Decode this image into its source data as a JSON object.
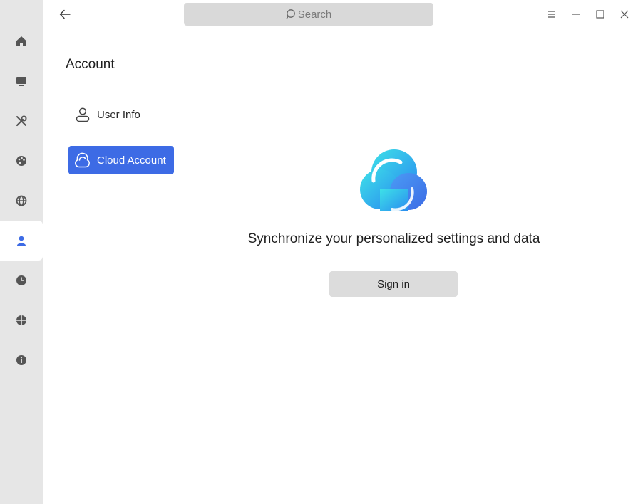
{
  "search": {
    "placeholder": "Search"
  },
  "rail": {
    "items": [
      {
        "name": "home",
        "icon": "home-icon"
      },
      {
        "name": "display",
        "icon": "monitor-icon"
      },
      {
        "name": "system",
        "icon": "tools-icon"
      },
      {
        "name": "personalize",
        "icon": "palette-icon"
      },
      {
        "name": "network",
        "icon": "globe-icon"
      },
      {
        "name": "account",
        "icon": "user-icon",
        "active": true
      },
      {
        "name": "datetime",
        "icon": "clock-icon"
      },
      {
        "name": "update",
        "icon": "update-icon"
      },
      {
        "name": "about",
        "icon": "info-icon"
      }
    ]
  },
  "nav": {
    "section_title": "Account",
    "items": [
      {
        "label": "User Info",
        "icon": "user-outline-icon"
      },
      {
        "label": "Cloud Account",
        "icon": "cloud-icon",
        "active": true
      }
    ]
  },
  "main": {
    "message": "Synchronize your personalized settings and data",
    "sign_in_label": "Sign in"
  },
  "colors": {
    "accent": "#3d6be5",
    "rail_bg": "#e6e6e6",
    "button_bg": "#dcdcdc"
  }
}
